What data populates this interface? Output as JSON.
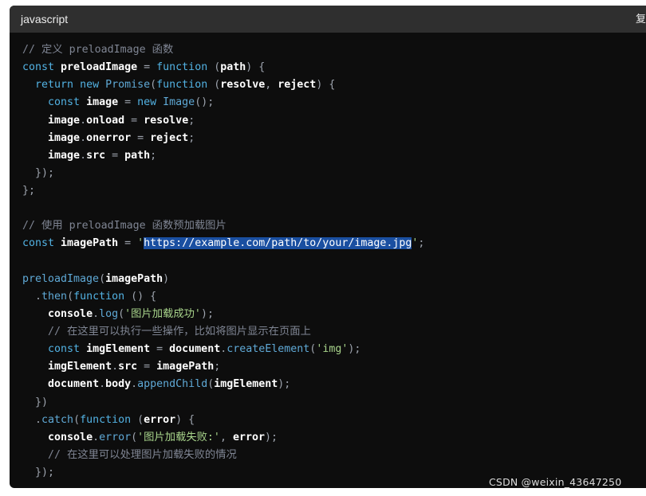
{
  "header": {
    "language": "javascript",
    "copy_label": "复"
  },
  "code": {
    "lines": [
      [
        {
          "t": "// 定义 preloadImage 函数",
          "c": "comment"
        }
      ],
      [
        {
          "t": "const ",
          "c": "keyword"
        },
        {
          "t": "preloadImage",
          "c": "ident"
        },
        {
          "t": " = ",
          "c": "punct"
        },
        {
          "t": "function",
          "c": "keyword"
        },
        {
          "t": " (",
          "c": "punct"
        },
        {
          "t": "path",
          "c": "ident"
        },
        {
          "t": ") {",
          "c": "punct"
        }
      ],
      [
        {
          "t": "  return ",
          "c": "keyword"
        },
        {
          "t": "new ",
          "c": "keyword"
        },
        {
          "t": "Promise",
          "c": "func"
        },
        {
          "t": "(",
          "c": "punct"
        },
        {
          "t": "function",
          "c": "keyword"
        },
        {
          "t": " (",
          "c": "punct"
        },
        {
          "t": "resolve",
          "c": "ident"
        },
        {
          "t": ", ",
          "c": "punct"
        },
        {
          "t": "reject",
          "c": "ident"
        },
        {
          "t": ") {",
          "c": "punct"
        }
      ],
      [
        {
          "t": "    const ",
          "c": "keyword"
        },
        {
          "t": "image",
          "c": "ident"
        },
        {
          "t": " = ",
          "c": "punct"
        },
        {
          "t": "new ",
          "c": "keyword"
        },
        {
          "t": "Image",
          "c": "func"
        },
        {
          "t": "();",
          "c": "punct"
        }
      ],
      [
        {
          "t": "    ",
          "c": "plain"
        },
        {
          "t": "image",
          "c": "ident"
        },
        {
          "t": ".",
          "c": "punct"
        },
        {
          "t": "onload",
          "c": "ident"
        },
        {
          "t": " = ",
          "c": "punct"
        },
        {
          "t": "resolve",
          "c": "ident"
        },
        {
          "t": ";",
          "c": "punct"
        }
      ],
      [
        {
          "t": "    ",
          "c": "plain"
        },
        {
          "t": "image",
          "c": "ident"
        },
        {
          "t": ".",
          "c": "punct"
        },
        {
          "t": "onerror",
          "c": "ident"
        },
        {
          "t": " = ",
          "c": "punct"
        },
        {
          "t": "reject",
          "c": "ident"
        },
        {
          "t": ";",
          "c": "punct"
        }
      ],
      [
        {
          "t": "    ",
          "c": "plain"
        },
        {
          "t": "image",
          "c": "ident"
        },
        {
          "t": ".",
          "c": "punct"
        },
        {
          "t": "src",
          "c": "ident"
        },
        {
          "t": " = ",
          "c": "punct"
        },
        {
          "t": "path",
          "c": "ident"
        },
        {
          "t": ";",
          "c": "punct"
        }
      ],
      [
        {
          "t": "  });",
          "c": "punct"
        }
      ],
      [
        {
          "t": "};",
          "c": "punct"
        }
      ],
      [],
      [
        {
          "t": "// 使用 preloadImage 函数预加载图片",
          "c": "comment"
        }
      ],
      [
        {
          "t": "const ",
          "c": "keyword"
        },
        {
          "t": "imagePath",
          "c": "ident"
        },
        {
          "t": " = ",
          "c": "punct"
        },
        {
          "t": "'",
          "c": "string"
        },
        {
          "t": "https://example.com/path/to/your/image.jpg",
          "c": "selected"
        },
        {
          "t": "'",
          "c": "string"
        },
        {
          "t": ";",
          "c": "punct"
        }
      ],
      [],
      [
        {
          "t": "preloadImage",
          "c": "func"
        },
        {
          "t": "(",
          "c": "punct"
        },
        {
          "t": "imagePath",
          "c": "ident"
        },
        {
          "t": ")",
          "c": "punct"
        }
      ],
      [
        {
          "t": "  .",
          "c": "punct"
        },
        {
          "t": "then",
          "c": "func"
        },
        {
          "t": "(",
          "c": "punct"
        },
        {
          "t": "function",
          "c": "keyword"
        },
        {
          "t": " () {",
          "c": "punct"
        }
      ],
      [
        {
          "t": "    ",
          "c": "plain"
        },
        {
          "t": "console",
          "c": "ident"
        },
        {
          "t": ".",
          "c": "punct"
        },
        {
          "t": "log",
          "c": "func"
        },
        {
          "t": "(",
          "c": "punct"
        },
        {
          "t": "'图片加载成功'",
          "c": "string"
        },
        {
          "t": ");",
          "c": "punct"
        }
      ],
      [
        {
          "t": "    // 在这里可以执行一些操作，比如将图片显示在页面上",
          "c": "comment"
        }
      ],
      [
        {
          "t": "    const ",
          "c": "keyword"
        },
        {
          "t": "imgElement",
          "c": "ident"
        },
        {
          "t": " = ",
          "c": "punct"
        },
        {
          "t": "document",
          "c": "ident"
        },
        {
          "t": ".",
          "c": "punct"
        },
        {
          "t": "createElement",
          "c": "func"
        },
        {
          "t": "(",
          "c": "punct"
        },
        {
          "t": "'img'",
          "c": "string"
        },
        {
          "t": ");",
          "c": "punct"
        }
      ],
      [
        {
          "t": "    ",
          "c": "plain"
        },
        {
          "t": "imgElement",
          "c": "ident"
        },
        {
          "t": ".",
          "c": "punct"
        },
        {
          "t": "src",
          "c": "ident"
        },
        {
          "t": " = ",
          "c": "punct"
        },
        {
          "t": "imagePath",
          "c": "ident"
        },
        {
          "t": ";",
          "c": "punct"
        }
      ],
      [
        {
          "t": "    ",
          "c": "plain"
        },
        {
          "t": "document",
          "c": "ident"
        },
        {
          "t": ".",
          "c": "punct"
        },
        {
          "t": "body",
          "c": "ident"
        },
        {
          "t": ".",
          "c": "punct"
        },
        {
          "t": "appendChild",
          "c": "func"
        },
        {
          "t": "(",
          "c": "punct"
        },
        {
          "t": "imgElement",
          "c": "ident"
        },
        {
          "t": ");",
          "c": "punct"
        }
      ],
      [
        {
          "t": "  })",
          "c": "punct"
        }
      ],
      [
        {
          "t": "  .",
          "c": "punct"
        },
        {
          "t": "catch",
          "c": "func"
        },
        {
          "t": "(",
          "c": "punct"
        },
        {
          "t": "function",
          "c": "keyword"
        },
        {
          "t": " (",
          "c": "punct"
        },
        {
          "t": "error",
          "c": "ident"
        },
        {
          "t": ") {",
          "c": "punct"
        }
      ],
      [
        {
          "t": "    ",
          "c": "plain"
        },
        {
          "t": "console",
          "c": "ident"
        },
        {
          "t": ".",
          "c": "punct"
        },
        {
          "t": "error",
          "c": "func"
        },
        {
          "t": "(",
          "c": "punct"
        },
        {
          "t": "'图片加载失败:'",
          "c": "string"
        },
        {
          "t": ", ",
          "c": "punct"
        },
        {
          "t": "error",
          "c": "ident"
        },
        {
          "t": ");",
          "c": "punct"
        }
      ],
      [
        {
          "t": "    // 在这里可以处理图片加载失败的情况",
          "c": "comment"
        }
      ],
      [
        {
          "t": "  });",
          "c": "punct"
        }
      ]
    ]
  },
  "watermark": "CSDN @weixin_43647250",
  "colors": {
    "background": "#0d0d0d",
    "header": "#2f2f2f",
    "keyword": "#52b2e3",
    "string": "#a8d48b",
    "comment": "#7f8593",
    "selection": "#1a4fa1"
  }
}
